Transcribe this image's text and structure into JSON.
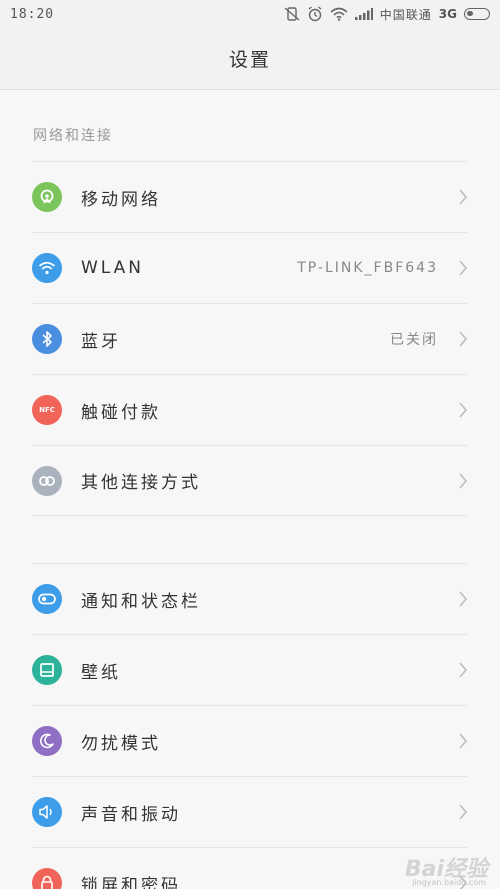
{
  "status_bar": {
    "time": "18:20",
    "carrier": "中国联通",
    "network": "3G"
  },
  "header": {
    "title": "设置"
  },
  "sections": [
    {
      "title": "网络和连接",
      "items": [
        {
          "label": "移动网络",
          "value": "",
          "icon": "mobile-network-icon",
          "color": "#7cc55c"
        },
        {
          "label": "WLAN",
          "value": "TP-LINK_FBF643",
          "icon": "wifi-icon",
          "color": "#3d9de8"
        },
        {
          "label": "蓝牙",
          "value": "已关闭",
          "icon": "bluetooth-icon",
          "color": "#4a8ee0"
        },
        {
          "label": "触碰付款",
          "value": "",
          "icon": "nfc-icon",
          "color": "#f0645a",
          "icon_text": "NFC"
        },
        {
          "label": "其他连接方式",
          "value": "",
          "icon": "link-icon",
          "color": "#a9b2bd"
        }
      ]
    },
    {
      "title": "",
      "items": [
        {
          "label": "通知和状态栏",
          "value": "",
          "icon": "toggle-icon",
          "color": "#3d9de8"
        },
        {
          "label": "壁纸",
          "value": "",
          "icon": "wallpaper-icon",
          "color": "#2cb39a"
        },
        {
          "label": "勿扰模式",
          "value": "",
          "icon": "moon-icon",
          "color": "#8f6fc4"
        },
        {
          "label": "声音和振动",
          "value": "",
          "icon": "speaker-icon",
          "color": "#3d9de8"
        },
        {
          "label": "锁屏和密码",
          "value": "",
          "icon": "lock-icon",
          "color": "#f0645a"
        }
      ]
    }
  ],
  "watermark": {
    "text": "Bai经验",
    "sub": "jingyan.baidu.com"
  }
}
